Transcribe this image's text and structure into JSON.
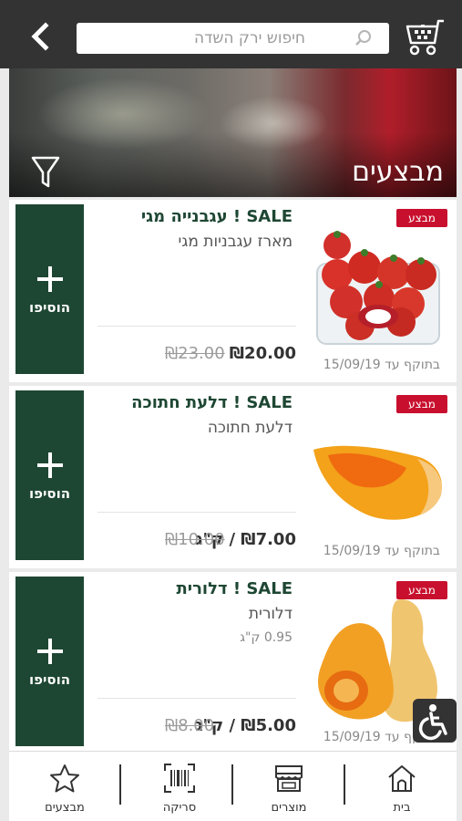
{
  "search": {
    "placeholder": "חיפוש ירק השדה"
  },
  "hero": {
    "title": "מבצעים"
  },
  "products": [
    {
      "badge": "מבצע",
      "title": "SALE ! עגבנייה מגי",
      "subtitle": "מארז עגבניות מגי",
      "weight": "",
      "price": "₪20.00",
      "old_price": "₪23.00",
      "validity": "בתוקף עד 15/09/19",
      "add_label": "הוסיפו",
      "image": "tomatoes-package"
    },
    {
      "badge": "מבצע",
      "title": "SALE ! דלעת חתוכה",
      "subtitle": "דלעת חתוכה",
      "weight": "",
      "price": "₪7.00 / ק\"ג",
      "old_price": "₪10.00",
      "validity": "בתוקף עד 15/09/19",
      "add_label": "הוסיפו",
      "image": "pumpkin-slice"
    },
    {
      "badge": "מבצע",
      "title": "SALE ! דלורית",
      "subtitle": "דלורית",
      "weight": "0.95 ק\"ג",
      "price": "₪5.00 / ק\"ג",
      "old_price": "₪8.00",
      "validity": "בתוקף עד 15/09/19",
      "add_label": "הוסיפו",
      "image": "butternut-squash"
    }
  ],
  "bottom_nav": [
    {
      "label": "מבצעים",
      "icon": "star-icon"
    },
    {
      "label": "סריקה",
      "icon": "barcode-icon"
    },
    {
      "label": "מוצרים",
      "icon": "store-icon"
    },
    {
      "label": "בית",
      "icon": "home-icon"
    }
  ],
  "colors": {
    "topbar": "#333333",
    "accent_green": "#1e4733",
    "badge_red": "#c8102e"
  }
}
